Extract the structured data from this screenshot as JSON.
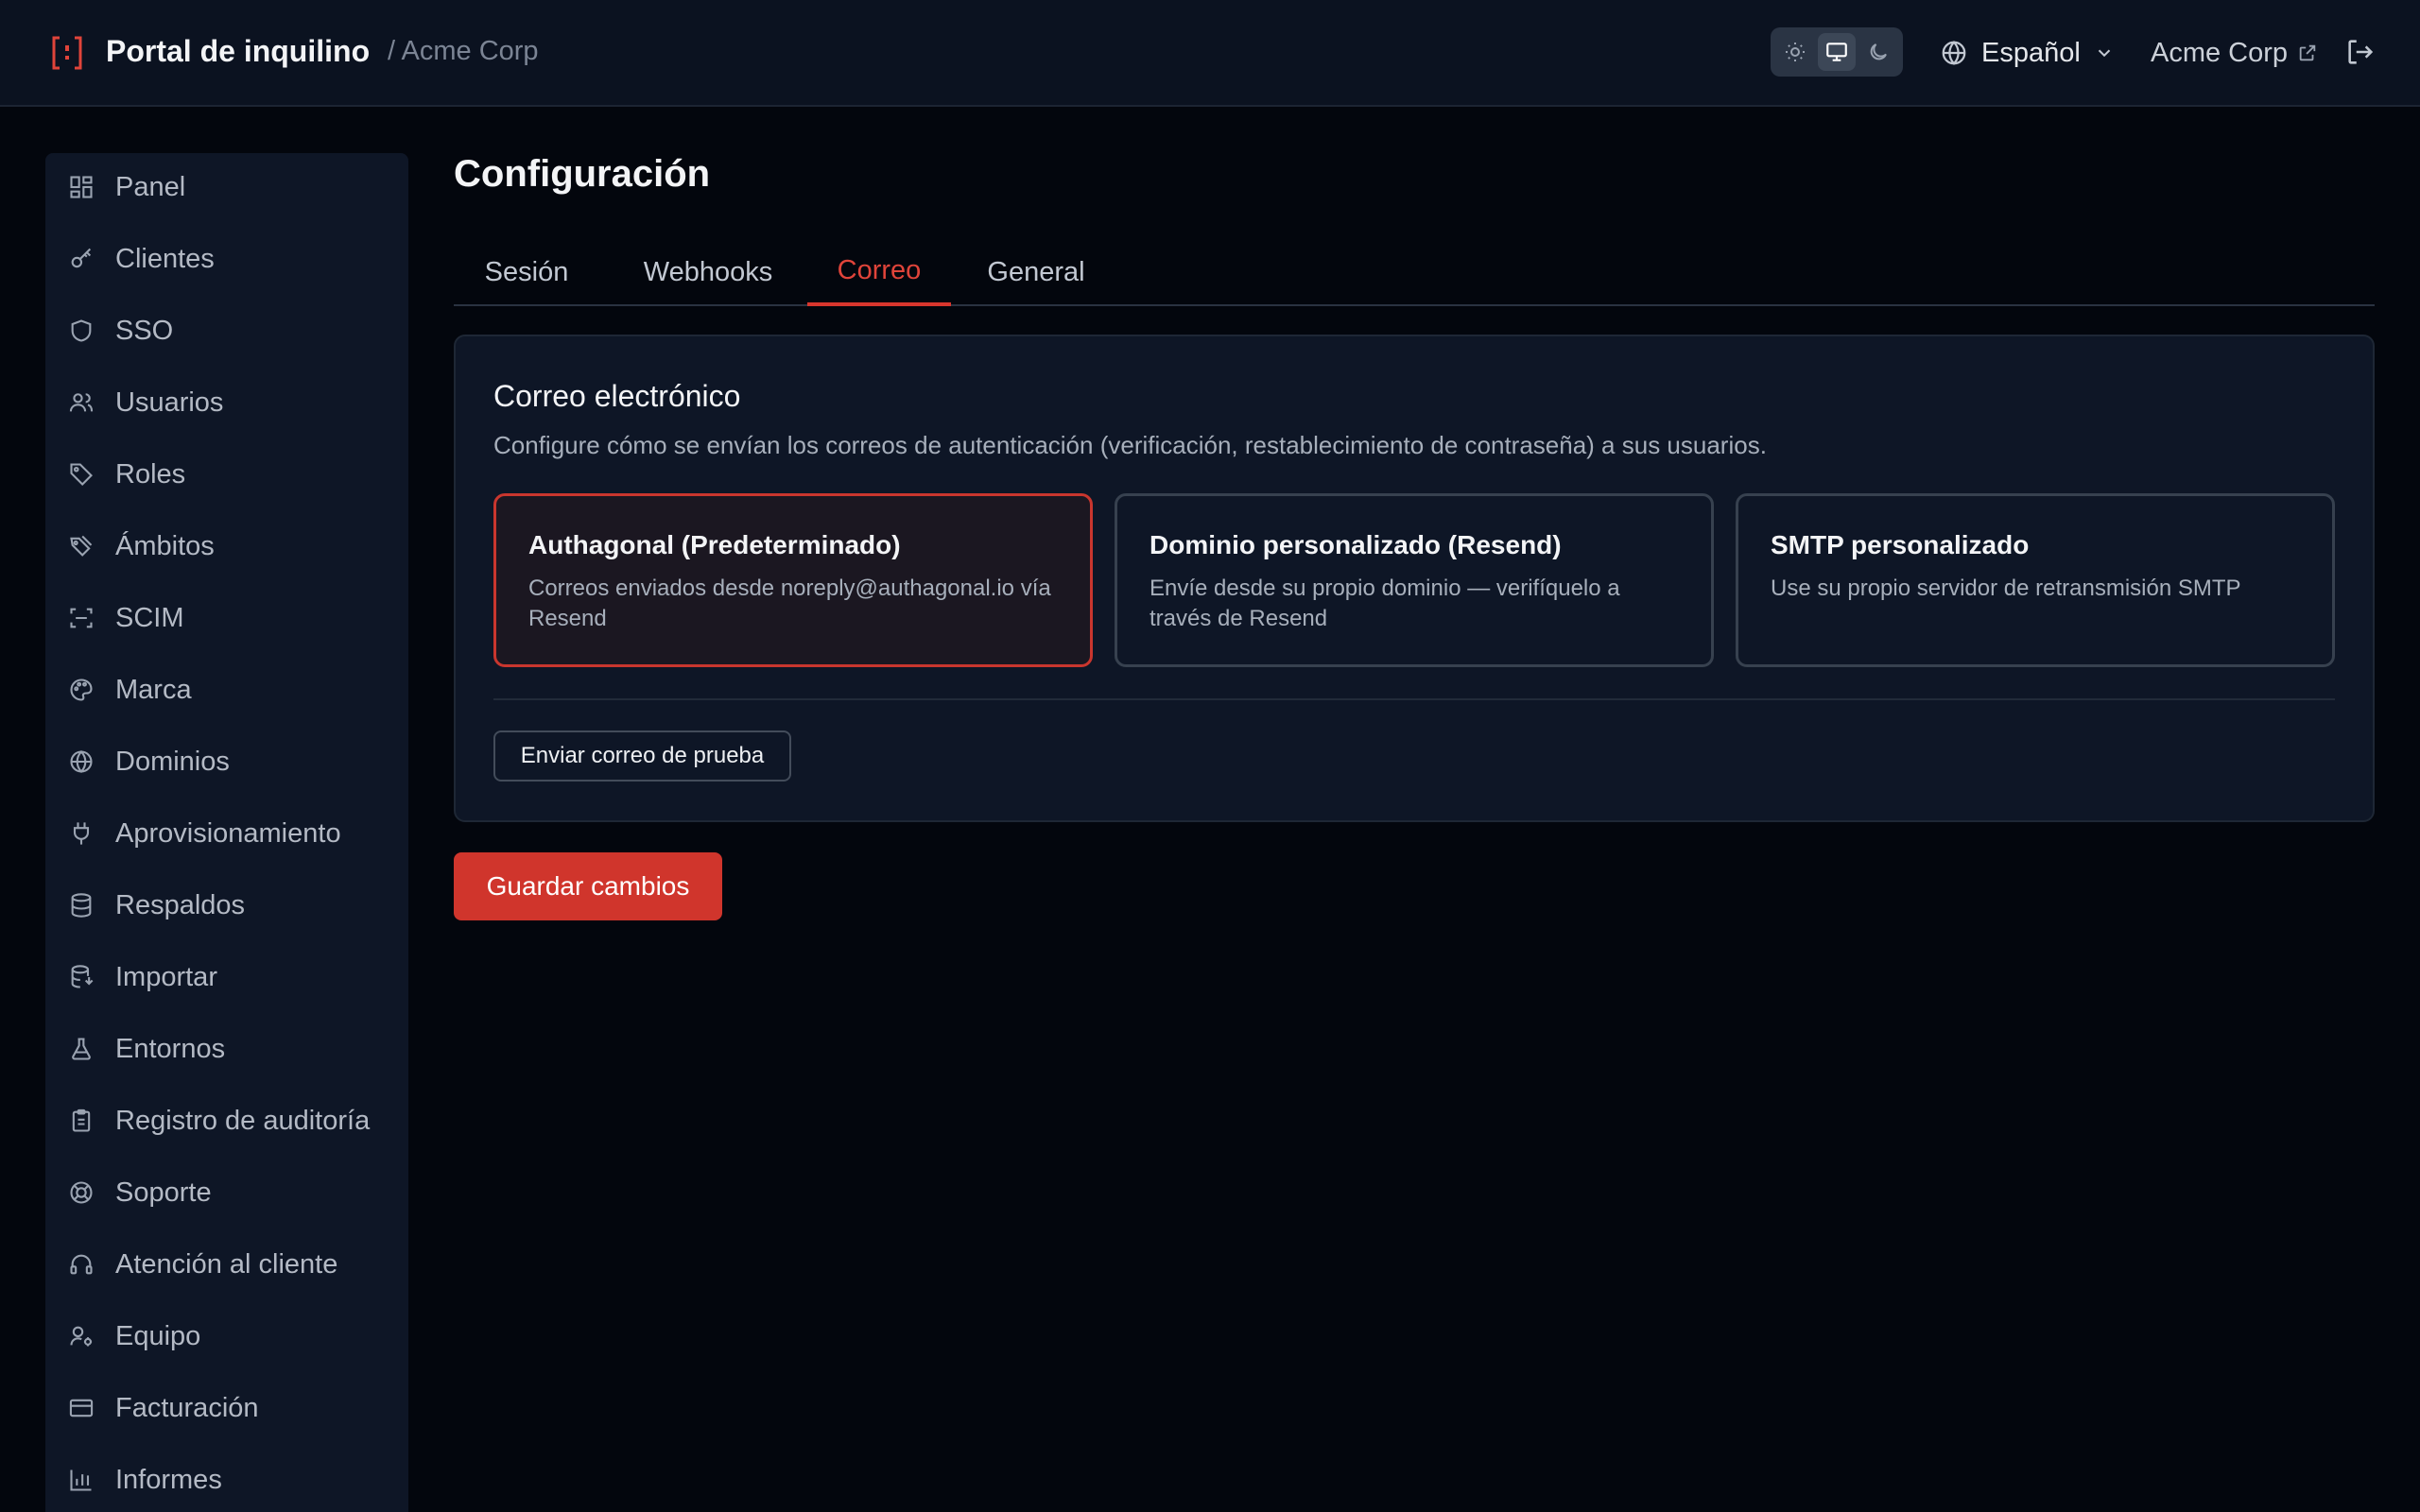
{
  "colors": {
    "accent": "#d0352c",
    "background": "#03060d",
    "header": "#0b1220",
    "panel": "#0e1626"
  },
  "header": {
    "title": "Portal de inquilino",
    "breadcrumb": "/ Acme Corp",
    "theme_modes": [
      "sun-icon",
      "monitor-icon",
      "moon-icon"
    ],
    "theme_active": "monitor-icon",
    "language": "Español",
    "tenant_link": "Acme Corp"
  },
  "sidebar": {
    "items": [
      {
        "label": "Panel",
        "icon": "dashboard-icon"
      },
      {
        "label": "Clientes",
        "icon": "key-icon"
      },
      {
        "label": "SSO",
        "icon": "shield-icon"
      },
      {
        "label": "Usuarios",
        "icon": "users-icon"
      },
      {
        "label": "Roles",
        "icon": "tag-icon"
      },
      {
        "label": "Ámbitos",
        "icon": "tags-icon"
      },
      {
        "label": "SCIM",
        "icon": "scan-icon"
      },
      {
        "label": "Marca",
        "icon": "palette-icon"
      },
      {
        "label": "Dominios",
        "icon": "globe-icon"
      },
      {
        "label": "Aprovisionamiento",
        "icon": "plug-icon"
      },
      {
        "label": "Respaldos",
        "icon": "database-icon"
      },
      {
        "label": "Importar",
        "icon": "database-import-icon"
      },
      {
        "label": "Entornos",
        "icon": "flask-icon"
      },
      {
        "label": "Registro de auditoría",
        "icon": "clipboard-icon"
      },
      {
        "label": "Soporte",
        "icon": "lifebuoy-icon"
      },
      {
        "label": "Atención al cliente",
        "icon": "headset-icon"
      },
      {
        "label": "Equipo",
        "icon": "user-cog-icon"
      },
      {
        "label": "Facturación",
        "icon": "credit-card-icon"
      },
      {
        "label": "Informes",
        "icon": "bar-chart-icon"
      }
    ]
  },
  "main": {
    "title": "Configuración",
    "tabs": [
      {
        "label": "Sesión"
      },
      {
        "label": "Webhooks"
      },
      {
        "label": "Correo"
      },
      {
        "label": "General"
      }
    ],
    "active_tab": "Correo",
    "email_card": {
      "title": "Correo electrónico",
      "description": "Configure cómo se envían los correos de autenticación (verificación, restablecimiento de contraseña) a sus usuarios.",
      "options": [
        {
          "title": "Authagonal (Predeterminado)",
          "description": "Correos enviados desde noreply@authagonal.io vía Resend",
          "selected": true
        },
        {
          "title": "Dominio personalizado (Resend)",
          "description": "Envíe desde su propio dominio — verifíquelo a través de Resend",
          "selected": false
        },
        {
          "title": "SMTP personalizado",
          "description": "Use su propio servidor de retransmisión SMTP",
          "selected": false
        }
      ],
      "test_button": "Enviar correo de prueba"
    },
    "save_button": "Guardar cambios"
  }
}
